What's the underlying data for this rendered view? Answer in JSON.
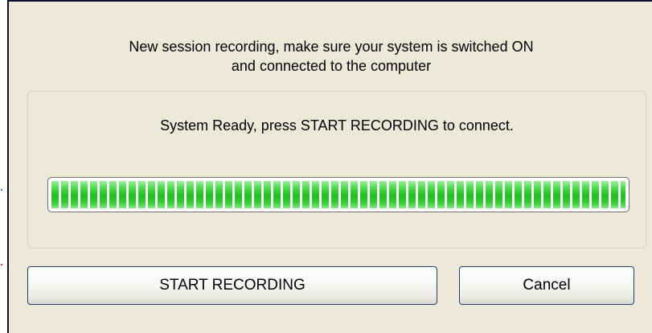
{
  "dialog": {
    "message_line1": "New session recording, make sure your system is switched ON",
    "message_line2": "and connected to the computer"
  },
  "status": {
    "text": "System Ready, press START RECORDING to connect.",
    "progress_percent": 100,
    "progress_color": "#2ecc2e"
  },
  "buttons": {
    "start_label": "START RECORDING",
    "cancel_label": "Cancel"
  }
}
